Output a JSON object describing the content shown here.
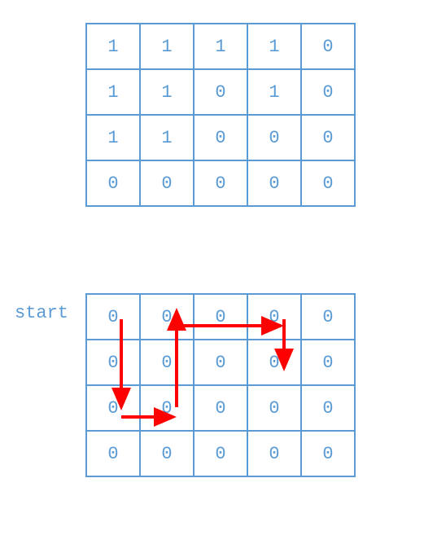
{
  "grid1": {
    "rows": [
      [
        "1",
        "1",
        "1",
        "1",
        "0"
      ],
      [
        "1",
        "1",
        "0",
        "1",
        "0"
      ],
      [
        "1",
        "1",
        "0",
        "0",
        "0"
      ],
      [
        "0",
        "0",
        "0",
        "0",
        "0"
      ]
    ]
  },
  "grid2": {
    "rows": [
      [
        "0",
        "0",
        "0",
        "0",
        "0"
      ],
      [
        "0",
        "0",
        "0",
        "0",
        "0"
      ],
      [
        "0",
        "0",
        "0",
        "0",
        "0"
      ],
      [
        "0",
        "0",
        "0",
        "0",
        "0"
      ]
    ],
    "highlighted": [
      [
        0,
        0
      ],
      [
        0,
        1
      ],
      [
        0,
        2
      ],
      [
        0,
        3
      ],
      [
        1,
        0
      ],
      [
        1,
        1
      ],
      [
        1,
        3
      ],
      [
        2,
        0
      ],
      [
        2,
        1
      ]
    ]
  },
  "label_start": "start",
  "colors": {
    "grid_border": "#5B9BD5",
    "text_blue": "#5B9BD5",
    "arrow_red": "#FF0000"
  },
  "arrows": {
    "description": "DFS/BFS traversal path over connected 1-region",
    "segments": [
      {
        "name": "down-col0",
        "from": "r0c0",
        "to": "r2c0"
      },
      {
        "name": "right-row2",
        "from": "r2c0",
        "to": "r2c1"
      },
      {
        "name": "up-col1",
        "from": "r2c1",
        "to": "r0c1"
      },
      {
        "name": "right-row0",
        "from": "r0c1",
        "to": "r0c3"
      },
      {
        "name": "down-col3",
        "from": "r0c3",
        "to": "r1c3"
      }
    ]
  }
}
